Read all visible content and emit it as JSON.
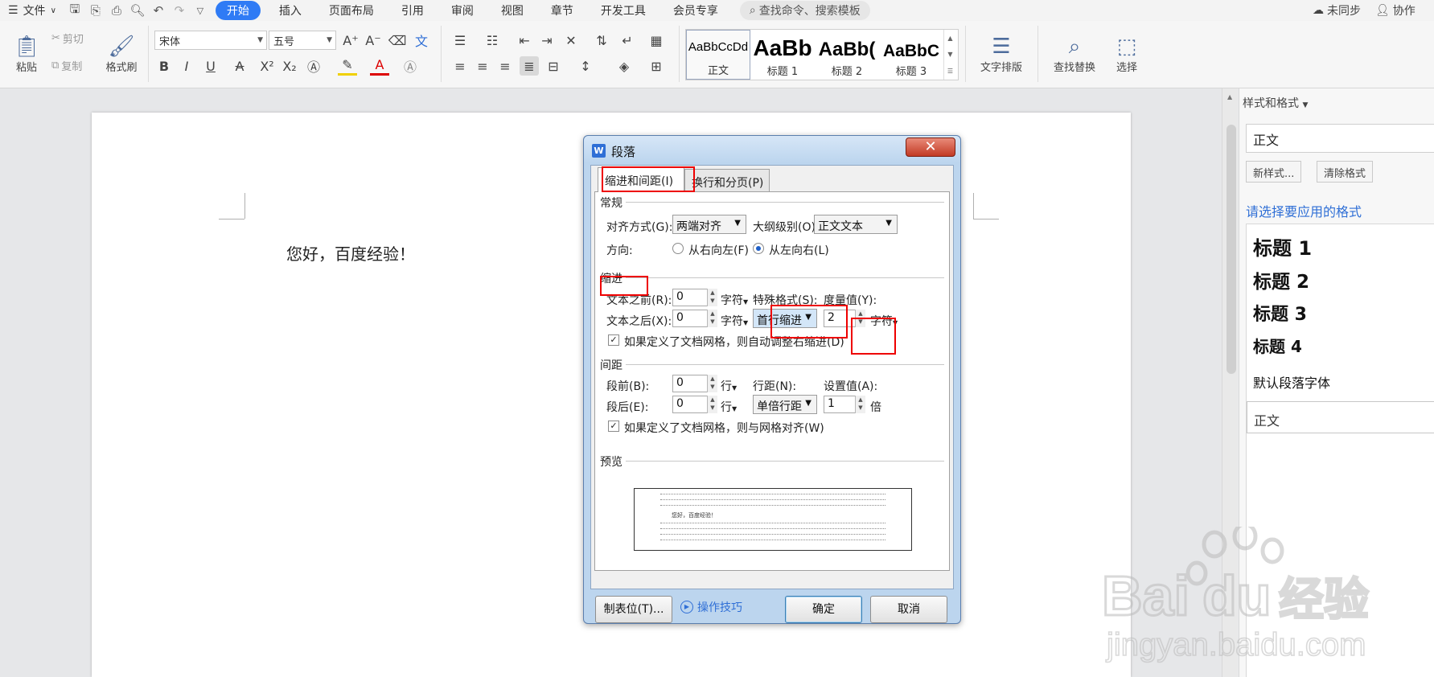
{
  "menubar": {
    "file": "文件",
    "tabs": [
      "开始",
      "插入",
      "页面布局",
      "引用",
      "审阅",
      "视图",
      "章节",
      "开发工具",
      "会员专享"
    ],
    "search_placeholder": "查找命令、搜索模板",
    "sync_status": "未同步",
    "collab": "协作"
  },
  "ribbon": {
    "paste": "粘贴",
    "cut": "剪切",
    "copy": "复制",
    "format_painter": "格式刷",
    "font_name": "宋体",
    "font_size": "五号",
    "style_gallery": [
      {
        "sample": "AaBbCcDd",
        "label": "正文"
      },
      {
        "sample": "AaBb",
        "label": "标题 1"
      },
      {
        "sample": "AaBb(",
        "label": "标题 2"
      },
      {
        "sample": "AaBbC",
        "label": "标题 3"
      }
    ],
    "text_layout": "文字排版",
    "find_replace": "查找替换",
    "select": "选择"
  },
  "document": {
    "text": "您好，百度经验！"
  },
  "styles_pane": {
    "title": "样式和格式",
    "current_style": "正文",
    "new_style": "新样式...",
    "clear_format": "清除格式",
    "hint": "请选择要应用的格式",
    "items": [
      "标题  1",
      "标题  2",
      "标题  3",
      "标题  4",
      "默认段落字体",
      "正文"
    ]
  },
  "dialog": {
    "title": "段落",
    "close": "✕",
    "tabs": [
      "缩进和间距(I)",
      "换行和分页(P)"
    ],
    "general": {
      "heading": "常规",
      "alignment_label": "对齐方式(G):",
      "alignment_value": "两端对齐",
      "outline_label": "大纲级别(O):",
      "outline_value": "正文文本",
      "direction_label": "方向:",
      "rtl": "从右向左(F)",
      "ltr": "从左向右(L)"
    },
    "indent": {
      "heading": "缩进",
      "before_label": "文本之前(R):",
      "before_value": "0",
      "after_label": "文本之后(X):",
      "after_value": "0",
      "unit": "字符",
      "special_label": "特殊格式(S):",
      "special_value": "首行缩进",
      "amount_label": "度量值(Y):",
      "amount_value": "2",
      "auto_adjust": "如果定义了文档网格，则自动调整右缩进(D)"
    },
    "spacing": {
      "heading": "间距",
      "before_label": "段前(B):",
      "before_value": "0",
      "after_label": "段后(E):",
      "after_value": "0",
      "line_unit": "行",
      "line_spacing_label": "行距(N):",
      "line_spacing_value": "单倍行距",
      "setting_label": "设置值(A):",
      "setting_value": "1",
      "setting_unit": "倍",
      "snap_grid": "如果定义了文档网格，则与网格对齐(W)"
    },
    "preview": {
      "heading": "预览",
      "sample_text": "您好，百度经验！"
    },
    "tabs_button": "制表位(T)...",
    "tips": "操作技巧",
    "ok": "确定",
    "cancel": "取消"
  },
  "watermark": {
    "brand": "Bai",
    "brand2": "du",
    "cn": "经验",
    "url": "jingyan.baidu.com"
  },
  "colors": {
    "accent": "#2f7bf5",
    "highlight": "#e00000",
    "link": "#2f6fd6"
  }
}
